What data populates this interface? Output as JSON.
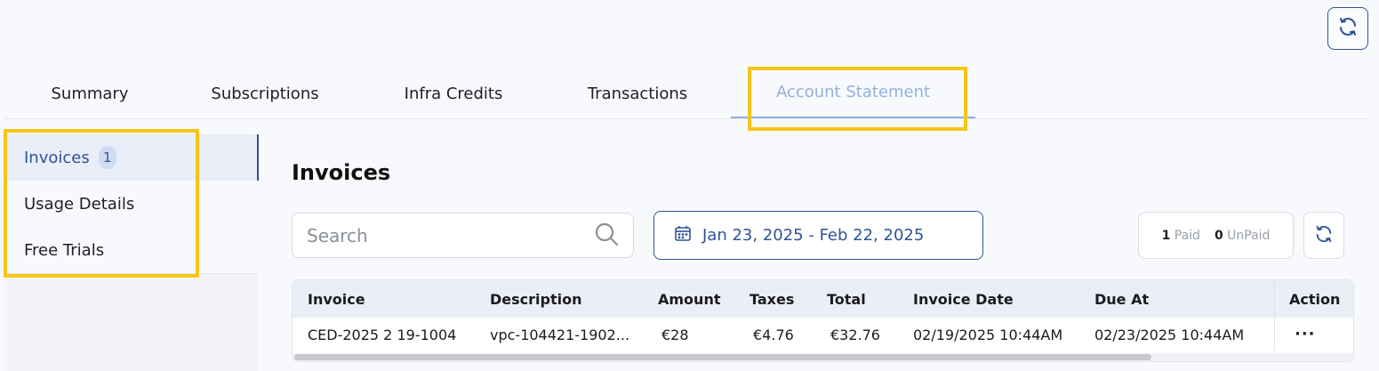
{
  "tabs": [
    {
      "label": "Summary"
    },
    {
      "label": "Subscriptions"
    },
    {
      "label": "Infra Credits"
    },
    {
      "label": "Transactions"
    },
    {
      "label": "Account Statement"
    }
  ],
  "sidebar": {
    "items": [
      {
        "label": "Invoices",
        "badge": "1"
      },
      {
        "label": "Usage Details"
      },
      {
        "label": "Free Trials"
      }
    ]
  },
  "main": {
    "title": "Invoices",
    "search_placeholder": "Search",
    "date_range": "Jan 23, 2025 - Feb 22, 2025",
    "paid_count": "1",
    "paid_label": "Paid",
    "unpaid_count": "0",
    "unpaid_label": "UnPaid"
  },
  "table": {
    "columns": [
      "Invoice",
      "Description",
      "Amount",
      "Taxes",
      "Total",
      "Invoice Date",
      "Due At",
      "Action"
    ],
    "rows": [
      {
        "invoice": "CED-2025 2 19-1004",
        "description": "vpc-104421-1902...",
        "amount": "€28",
        "taxes": "€4.76",
        "total": "€32.76",
        "invoice_date": "02/19/2025 10:44AM",
        "due_at": "02/23/2025 10:44AM",
        "action": "···"
      }
    ]
  },
  "colors": {
    "accent": "#2f5496",
    "active_tab": "#93b0de",
    "highlight": "#f5c518"
  },
  "icons": [
    "refresh-icon",
    "search-icon",
    "calendar-icon",
    "more-icon"
  ]
}
